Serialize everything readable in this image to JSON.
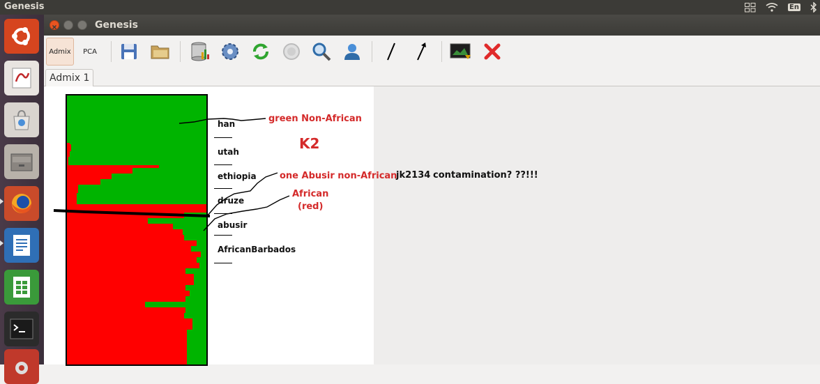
{
  "top_panel": {
    "app_title": "Genesis",
    "language": "En"
  },
  "window": {
    "title": "Genesis"
  },
  "toolbar": {
    "admix_label": "Admix",
    "pca_label": "PCA"
  },
  "tabs": [
    {
      "label": "Admix 1"
    }
  ],
  "plot": {
    "populations": [
      "han",
      "utah",
      "ethiopia",
      "druze",
      "abusir",
      "AfricanBarbados"
    ],
    "colors": {
      "african": "#ff0000",
      "non_african": "#00b400"
    },
    "red_fraction_rows": [
      0,
      0,
      0,
      0,
      0,
      0,
      0,
      0,
      0,
      0,
      0,
      0,
      0,
      0,
      0,
      0,
      0,
      0,
      0,
      0,
      0,
      0,
      0,
      0,
      0,
      0,
      0,
      0,
      0,
      0,
      0,
      0,
      0,
      0,
      0.02,
      0.03,
      0.03,
      0.03,
      0.03,
      0.03,
      0.02,
      0.02,
      0.02,
      0.02,
      0.01,
      0.01,
      0.01,
      0.01,
      0.01,
      0.01,
      0.66,
      0.66,
      0.47,
      0.47,
      0.47,
      0.47,
      0.32,
      0.32,
      0.32,
      0.32,
      0.24,
      0.24,
      0.24,
      0.24,
      0.08,
      0.08,
      0.08,
      0.08,
      0.08,
      0.08,
      0.07,
      0.07,
      0.07,
      0.07,
      0.07,
      0.07,
      0.07,
      0.07,
      1,
      1,
      1,
      1,
      1,
      1,
      0.84,
      0.84,
      0.84,
      0.84,
      0.58,
      0.58,
      0.58,
      0.58,
      0.76,
      0.76,
      0.76,
      0.76,
      0.83,
      0.83,
      0.83,
      0.83,
      0.84,
      0.84,
      0.84,
      0.84,
      0.93,
      0.93,
      0.93,
      0.93,
      0.89,
      0.89,
      0.89,
      0.89,
      0.96,
      0.96,
      0.96,
      0.96,
      0.93,
      0.93,
      0.93,
      0.93,
      0.95,
      0.95,
      0.95,
      0.95,
      0.85,
      0.85,
      0.85,
      0.85,
      0.91,
      0.91,
      0.91,
      0.91,
      0.91,
      0.91,
      0.91,
      0.91,
      0.85,
      0.85,
      0.85,
      0.85,
      0.88,
      0.88,
      0.88,
      0.88,
      0.85,
      0.85,
      0.85,
      0.85,
      0.56,
      0.56,
      0.56,
      0.56,
      0.85,
      0.85,
      0.85,
      0.85,
      0.84,
      0.84,
      0.84,
      0.84,
      0.9,
      0.9,
      0.9,
      0.9,
      0.9,
      0.9,
      0.9,
      0.9
    ]
  },
  "annotations": {
    "green_label": "green Non-African",
    "k_label": "K2",
    "abusir_note": "one Abusir non-African",
    "sample_id": "jk2134",
    "contamination_note": "contamination? ??!!!",
    "african_label_line1": "African",
    "african_label_line2": "(red)"
  }
}
